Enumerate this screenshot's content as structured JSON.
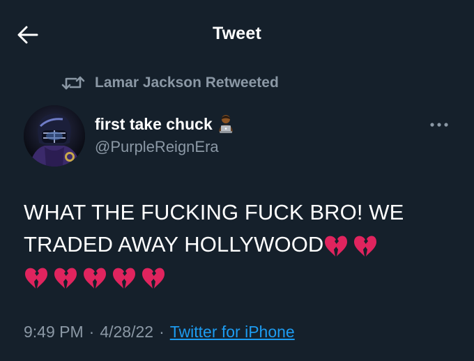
{
  "header": {
    "title": "Tweet",
    "back_icon": "arrow-left-icon"
  },
  "retweet": {
    "text": "Lamar Jackson Retweeted",
    "icon": "retweet-icon"
  },
  "author": {
    "name": "first take chuck",
    "name_emoji": "man-technologist-emoji",
    "handle": "@PurpleReignEra",
    "avatar_icon": "football-helmet-avatar"
  },
  "more_icon": "more-dots-icon",
  "tweet": {
    "line1": "WHAT THE FUCKING FUCK BRO! WE",
    "line2": "TRADED AWAY HOLLYWOOD",
    "emoji": "broken-heart-emoji",
    "line2_emoji_count": 2,
    "line3_emoji_count": 5
  },
  "meta": {
    "time": "9:49 PM",
    "date": "4/28/22",
    "separator": "·",
    "source": "Twitter for iPhone"
  },
  "colors": {
    "background": "#15202b",
    "text": "#ffffff",
    "secondary": "#8b98a5",
    "link": "#1d9bf0",
    "heart": "#e0245e"
  }
}
